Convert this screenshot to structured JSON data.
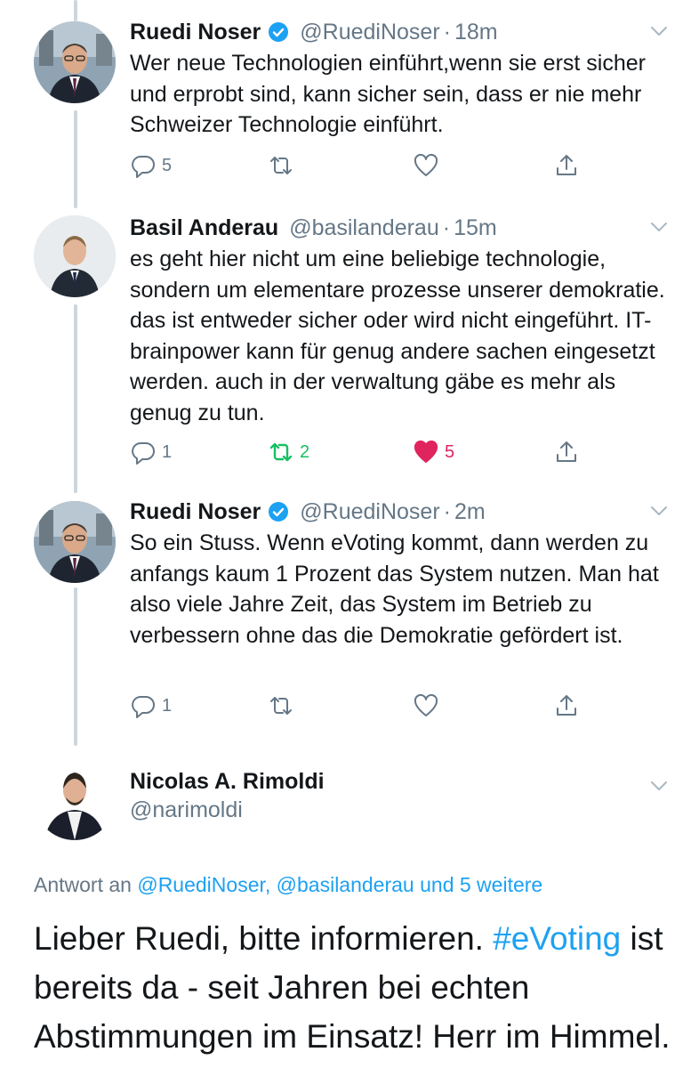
{
  "colors": {
    "accent": "#1da1f2",
    "secondary_text": "#657786",
    "retweet_active": "#17bf63",
    "like_active": "#e0245e",
    "thread_line": "#ccd6dd"
  },
  "tweets": [
    {
      "name": "Ruedi Noser",
      "verified": true,
      "handle": "@RuediNoser",
      "separator": "·",
      "time": "18m",
      "text": "Wer neue Technologien einführt,wenn sie erst sicher und erprobt sind, kann sicher sein, dass er nie mehr Schweizer Technologie einführt.",
      "reply_count": "5",
      "retweet_count": "",
      "like_count": "",
      "retweeted": false,
      "liked": false
    },
    {
      "name": "Basil Anderau",
      "verified": false,
      "handle": "@basilanderau",
      "separator": "·",
      "time": "15m",
      "text": "es geht hier nicht um eine beliebige technologie, sondern um elementare prozesse unserer demokratie. das ist entweder sicher oder wird nicht eingeführt. IT-brainpower kann für genug andere sachen eingesetzt werden. auch in der verwaltung gäbe es mehr als genug zu tun.",
      "reply_count": "1",
      "retweet_count": "2",
      "like_count": "5",
      "retweeted": true,
      "liked": true
    },
    {
      "name": "Ruedi Noser",
      "verified": true,
      "handle": "@RuediNoser",
      "separator": "·",
      "time": "2m",
      "text": "So ein Stuss. Wenn eVoting kommt, dann werden zu anfangs kaum 1 Prozent das System nutzen. Man hat also viele Jahre Zeit, das System im Betrieb zu verbessern ohne das die Demokratie gefördert ist.",
      "reply_count": "1",
      "retweet_count": "",
      "like_count": "",
      "retweeted": false,
      "liked": false
    }
  ],
  "focused_tweet": {
    "name": "Nicolas A. Rimoldi",
    "handle": "@narimoldi",
    "reply_to_prefix": "Antwort an",
    "reply_to_user1": "@RuediNoser,",
    "reply_to_user2": "@basilanderau",
    "reply_to_more": "und 5 weitere",
    "text_part1": "Lieber Ruedi, bitte informieren.",
    "hashtag": "#eVoting",
    "text_part2": "ist bereits da - seit Jahren bei echten Abstimmungen im Einsatz! Herr im Himmel."
  },
  "icons": {
    "reply": "reply-icon",
    "retweet": "retweet-icon",
    "like": "heart-icon",
    "share": "share-icon",
    "verified": "verified-badge-icon",
    "more": "chevron-down-icon"
  }
}
